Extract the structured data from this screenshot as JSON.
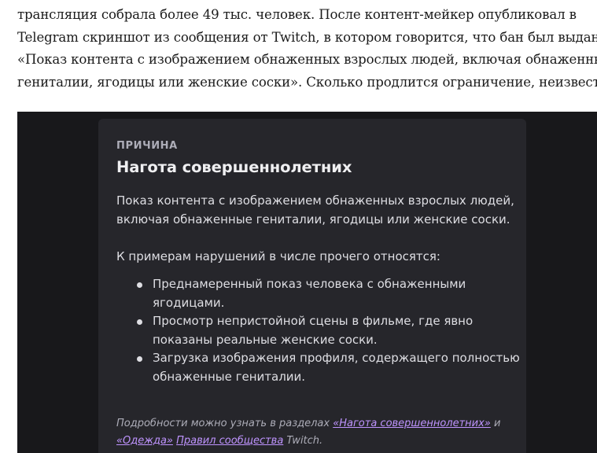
{
  "article": {
    "lines": [
      "трансляция собрала более 49 тыс. человек. После контент-мейкер опубликовал в",
      "Telegram скриншот из сообщения от Twitch, в котором говорится, что бан был выдан за",
      "«Показ контента с изображением обнаженных взрослых людей, включая обнаженные",
      "гениталии, ягодицы или женские соски». Сколько продлится ограничение, неизвестно."
    ]
  },
  "card": {
    "eyebrow": "ПРИЧИНА",
    "title": "Нагота совершеннолетних",
    "description_lines": [
      "Показ контента с изображением обнаженных взрослых людей,",
      "включая обнаженные гениталии, ягодицы или женские соски."
    ],
    "examples_intro": "К примерам нарушений в числе прочего относятся:",
    "examples": [
      {
        "lines": [
          "Преднамеренный показ человека с обнаженными",
          "ягодицами."
        ]
      },
      {
        "lines": [
          "Просмотр непристойной сцены в фильме, где явно",
          "показаны реальные женские соски."
        ]
      },
      {
        "lines": [
          "Загрузка изображения профиля, содержащего полностью",
          "обнаженные гениталии."
        ]
      }
    ],
    "footnote": {
      "prefix": "Подробности можно узнать в разделах ",
      "link1": "«Нагота совершеннолетних»",
      "and": " и",
      "link2": "«Одежда»",
      "space": " ",
      "link3": "Правил сообщества",
      "suffix": " Twitch."
    },
    "link_color": "#bf94ff",
    "background_color": "#26262b",
    "outer_background": "#18181b"
  }
}
